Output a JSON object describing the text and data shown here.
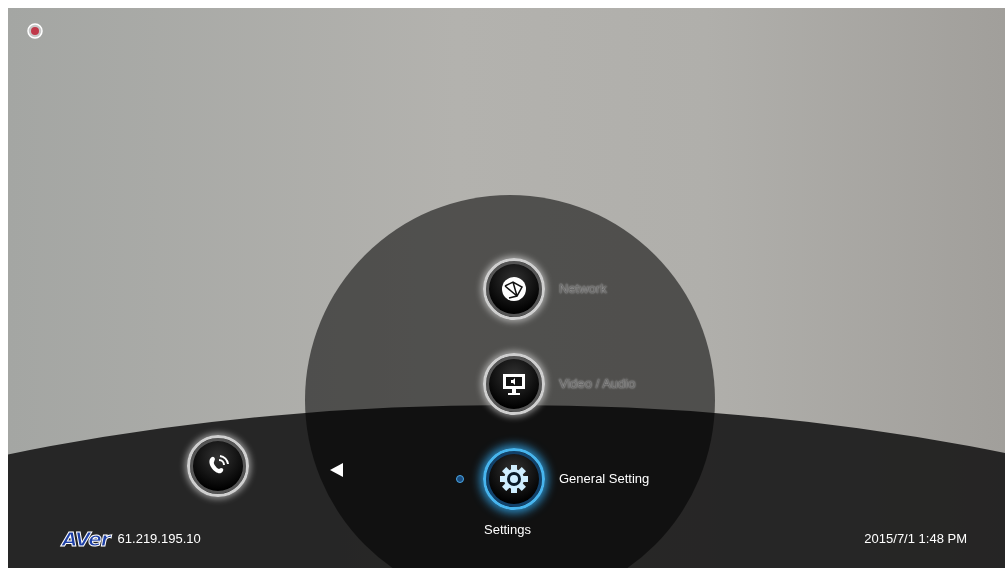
{
  "menu": {
    "title": "Settings",
    "items": [
      {
        "label": "Network",
        "selected": false
      },
      {
        "label": "Video / Audio",
        "selected": false
      },
      {
        "label": "General Setting",
        "selected": true
      }
    ]
  },
  "status_bar": {
    "logo": "AVer",
    "ip_address": "61.219.195.10",
    "datetime": "2015/7/1 1:48 PM"
  }
}
